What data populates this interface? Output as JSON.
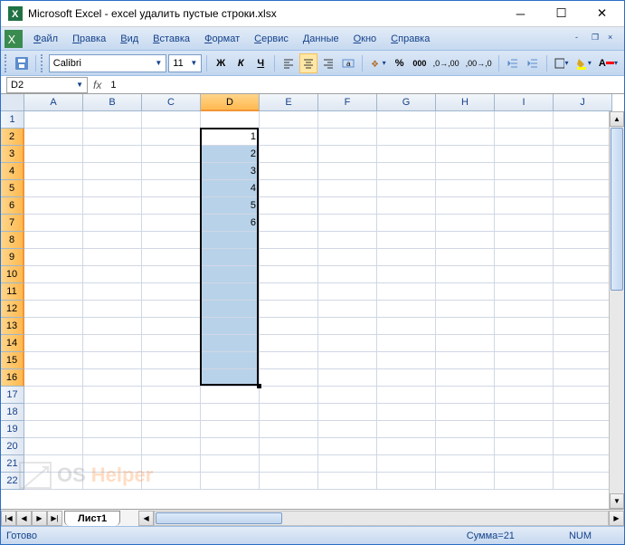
{
  "title": "Microsoft Excel - excel удалить пустые строки.xlsx",
  "menu": [
    "Файл",
    "Правка",
    "Вид",
    "Вставка",
    "Формат",
    "Сервис",
    "Данные",
    "Окно",
    "Справка"
  ],
  "font": {
    "name": "Calibri",
    "size": "11"
  },
  "namebox": "D2",
  "formula": "1",
  "columns": [
    "A",
    "B",
    "C",
    "D",
    "E",
    "F",
    "G",
    "H",
    "I",
    "J"
  ],
  "rows": [
    1,
    2,
    3,
    4,
    5,
    6,
    7,
    8,
    9,
    10,
    11,
    12,
    13,
    14,
    15,
    16,
    17,
    18,
    19,
    20,
    21,
    22
  ],
  "selected_column": "D",
  "selected_rows_start": 2,
  "selected_rows_end": 16,
  "active_cell": "D2",
  "cells": {
    "D2": "1",
    "D3": "2",
    "D4": "3",
    "D5": "4",
    "D6": "5",
    "D7": "6"
  },
  "sheet_tab": "Лист1",
  "status": {
    "ready": "Готово",
    "sum": "Сумма=21",
    "num": "NUM"
  },
  "watermark": {
    "os": "OS",
    "helper": "Helper"
  },
  "chart_data": {
    "type": "table",
    "columns": [
      "D"
    ],
    "rows": [
      {
        "row": 2,
        "D": 1
      },
      {
        "row": 3,
        "D": 2
      },
      {
        "row": 4,
        "D": 3
      },
      {
        "row": 5,
        "D": 4
      },
      {
        "row": 6,
        "D": 5
      },
      {
        "row": 7,
        "D": 6
      }
    ],
    "selection": "D2:D16",
    "sum": 21
  }
}
